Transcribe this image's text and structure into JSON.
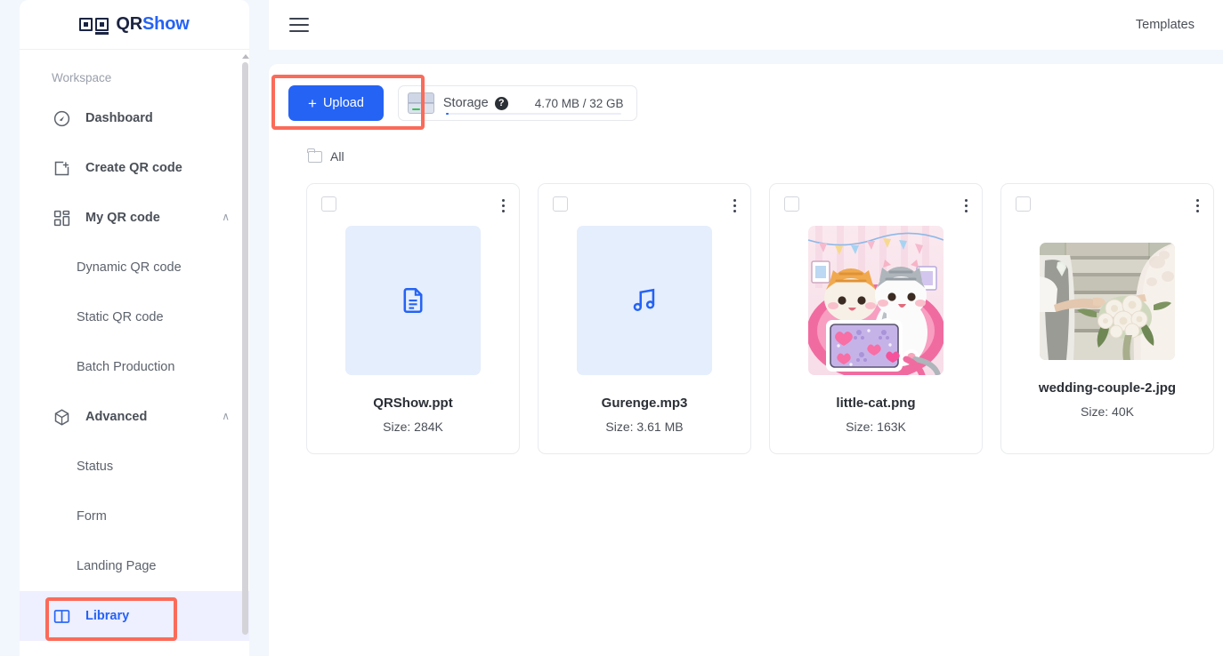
{
  "brand": {
    "qr": "QR",
    "show": "Show"
  },
  "sidebar": {
    "section_label": "Workspace",
    "items": [
      {
        "label": "Dashboard",
        "icon": "compass-icon",
        "level": "top",
        "chevron": ""
      },
      {
        "label": "Create QR code",
        "icon": "square-plus-icon",
        "level": "top",
        "chevron": ""
      },
      {
        "label": "My QR code",
        "icon": "qr-grid-icon",
        "level": "top",
        "chevron": "∧"
      },
      {
        "label": "Dynamic QR code",
        "icon": "",
        "level": "child",
        "chevron": ""
      },
      {
        "label": "Static QR code",
        "icon": "",
        "level": "child",
        "chevron": ""
      },
      {
        "label": "Batch Production",
        "icon": "",
        "level": "child",
        "chevron": ""
      },
      {
        "label": "Advanced",
        "icon": "cube-icon",
        "level": "top",
        "chevron": "∧"
      },
      {
        "label": "Status",
        "icon": "",
        "level": "child",
        "chevron": ""
      },
      {
        "label": "Form",
        "icon": "",
        "level": "child",
        "chevron": ""
      },
      {
        "label": "Landing Page",
        "icon": "",
        "level": "child",
        "chevron": ""
      },
      {
        "label": "Library",
        "icon": "book-icon",
        "level": "top",
        "chevron": "",
        "active": true
      }
    ]
  },
  "topbar": {
    "menu_icon": "hamburger-icon",
    "templates_label": "Templates"
  },
  "toolbar": {
    "upload_plus": "+",
    "upload_label": "Upload",
    "storage_label": "Storage",
    "storage_help": "?",
    "storage_value": "4.70 MB / 32 GB",
    "storage_used_percent": 1.5
  },
  "breadcrumb": {
    "folder_label": "All"
  },
  "files": [
    {
      "name": "QRShow.ppt",
      "size": "Size: 284K",
      "thumb": "doc-icon"
    },
    {
      "name": "Gurenge.mp3",
      "size": "Size: 3.61 MB",
      "thumb": "music-icon"
    },
    {
      "name": "little-cat.png",
      "size": "Size: 163K",
      "thumb": "cat-image"
    },
    {
      "name": "wedding-couple-2.jpg",
      "size": "Size: 40K",
      "thumb": "wedding-image"
    },
    {
      "name": "",
      "size": "",
      "thumb": ""
    }
  ],
  "annotations": {
    "accent_color": "#fa6b5a",
    "primary_color": "#2563f5"
  }
}
